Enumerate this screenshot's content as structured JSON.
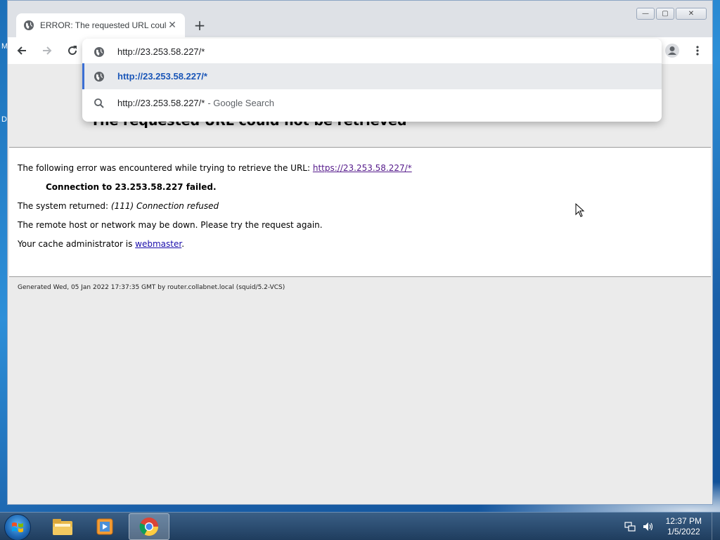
{
  "desktop": {
    "edge_letters": [
      "M",
      "D"
    ]
  },
  "browser": {
    "tab": {
      "title": "ERROR: The requested URL could not be retrieved",
      "close_glyph": "✕",
      "favicon": "globe-icon"
    },
    "new_tab_glyph": "+",
    "window_controls": {
      "minimize": "—",
      "maximize": "▢",
      "close": "✕"
    },
    "omnibox": {
      "input_value": "http://23.253.58.227/*",
      "suggestions": [
        {
          "icon": "globe-icon",
          "text": "http://23.253.58.227/*",
          "suffix": ""
        },
        {
          "icon": "search-icon",
          "text": "http://23.253.58.227/*",
          "suffix": "- Google Search"
        }
      ]
    },
    "accent_color": "#3b6fd4"
  },
  "page": {
    "heading": "The requested URL could not be retrieved",
    "error_intro": "The following error was encountered while trying to retrieve the URL:",
    "error_url": "https://23.253.58.227/*",
    "failure": "Connection to 23.253.58.227 failed.",
    "system_returned_label": "The system returned:",
    "system_returned_value": "(111) Connection refused",
    "remote_host_msg": "The remote host or network may be down. Please try the request again.",
    "admin_prefix": "Your cache administrator is",
    "admin_link": "webmaster",
    "admin_suffix": ".",
    "footer": "Generated Wed, 05 Jan 2022 17:37:35 GMT by router.collabnet.local (squid/5.2-VCS)"
  },
  "taskbar": {
    "apps": [
      "windows-explorer",
      "media-player",
      "chrome"
    ],
    "clock_time": "12:37 PM",
    "clock_date": "1/5/2022"
  }
}
